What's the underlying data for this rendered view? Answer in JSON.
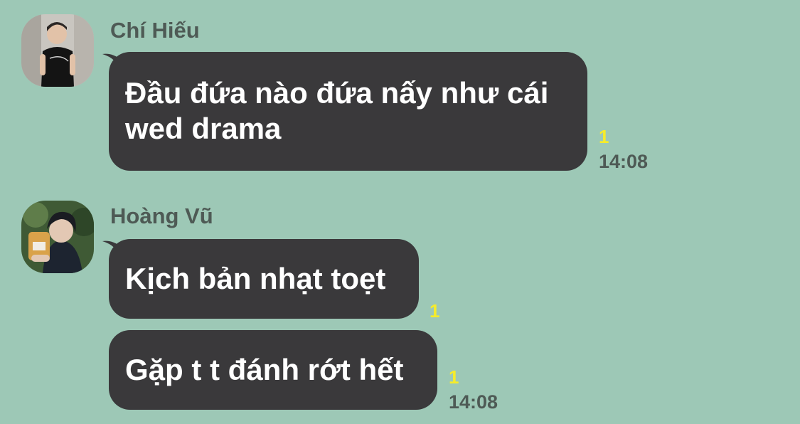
{
  "messages": [
    {
      "sender": "Chí Hiếu",
      "avatar": "profile-photo",
      "bubbles": [
        {
          "lines": [
            "Đầu đứa nào đứa nấy như cái",
            "wed drama"
          ],
          "unread": "1"
        }
      ],
      "time": "14:08"
    },
    {
      "sender": "Hoàng Vũ",
      "avatar": "profile-photo",
      "bubbles": [
        {
          "lines": [
            "Kịch bản nhạt toẹt"
          ],
          "unread": "1"
        },
        {
          "lines": [
            "Gặp t t đánh rớt hết"
          ],
          "unread": "1"
        }
      ],
      "time": "14:08"
    }
  ],
  "colors": {
    "background": "#9dc8b6",
    "bubble": "#3a393b",
    "bubble_text": "#ffffff",
    "unread": "#f6ec2a",
    "meta_text": "#4e5a55"
  }
}
